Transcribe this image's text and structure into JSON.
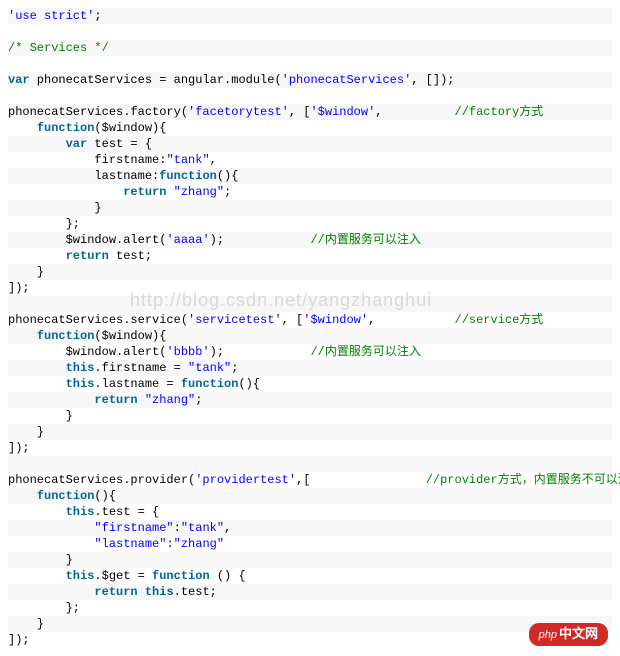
{
  "lines": [
    {
      "cls": "odd",
      "tokens": [
        {
          "t": "str",
          "x": "'use strict'"
        },
        {
          "t": "plain",
          "x": ";"
        }
      ]
    },
    {
      "cls": "even",
      "tokens": [
        {
          "t": "plain",
          "x": " "
        }
      ]
    },
    {
      "cls": "odd",
      "tokens": [
        {
          "t": "cmt",
          "x": "/* Services */"
        }
      ]
    },
    {
      "cls": "even",
      "tokens": [
        {
          "t": "plain",
          "x": " "
        }
      ]
    },
    {
      "cls": "odd",
      "tokens": [
        {
          "t": "kw",
          "x": "var"
        },
        {
          "t": "plain",
          "x": " phonecatServices = angular.module("
        },
        {
          "t": "str",
          "x": "'phonecatServices'"
        },
        {
          "t": "plain",
          "x": ", []);"
        }
      ]
    },
    {
      "cls": "even",
      "tokens": [
        {
          "t": "plain",
          "x": " "
        }
      ]
    },
    {
      "cls": "odd",
      "tokens": [
        {
          "t": "plain",
          "x": "phonecatServices.factory("
        },
        {
          "t": "str",
          "x": "'facetorytest'"
        },
        {
          "t": "plain",
          "x": ", ["
        },
        {
          "t": "str",
          "x": "'$window'"
        },
        {
          "t": "plain",
          "x": ",          "
        },
        {
          "t": "cmt",
          "x": "//factory方式"
        }
      ]
    },
    {
      "cls": "even",
      "tokens": [
        {
          "t": "plain",
          "x": "    "
        },
        {
          "t": "kw",
          "x": "function"
        },
        {
          "t": "plain",
          "x": "($window){"
        }
      ]
    },
    {
      "cls": "odd",
      "tokens": [
        {
          "t": "plain",
          "x": "        "
        },
        {
          "t": "kw",
          "x": "var"
        },
        {
          "t": "plain",
          "x": " test = {"
        }
      ]
    },
    {
      "cls": "even",
      "tokens": [
        {
          "t": "plain",
          "x": "            firstname:"
        },
        {
          "t": "str",
          "x": "\"tank\""
        },
        {
          "t": "plain",
          "x": ","
        }
      ]
    },
    {
      "cls": "odd",
      "tokens": [
        {
          "t": "plain",
          "x": "            lastname:"
        },
        {
          "t": "kw",
          "x": "function"
        },
        {
          "t": "plain",
          "x": "(){"
        }
      ]
    },
    {
      "cls": "even",
      "tokens": [
        {
          "t": "plain",
          "x": "                "
        },
        {
          "t": "kw",
          "x": "return"
        },
        {
          "t": "plain",
          "x": " "
        },
        {
          "t": "str",
          "x": "\"zhang\""
        },
        {
          "t": "plain",
          "x": ";"
        }
      ]
    },
    {
      "cls": "odd",
      "tokens": [
        {
          "t": "plain",
          "x": "            }"
        }
      ]
    },
    {
      "cls": "even",
      "tokens": [
        {
          "t": "plain",
          "x": "        };"
        }
      ]
    },
    {
      "cls": "odd",
      "tokens": [
        {
          "t": "plain",
          "x": "        $window.alert("
        },
        {
          "t": "str",
          "x": "'aaaa'"
        },
        {
          "t": "plain",
          "x": ");            "
        },
        {
          "t": "cmt",
          "x": "//内置服务可以注入"
        }
      ]
    },
    {
      "cls": "even",
      "tokens": [
        {
          "t": "plain",
          "x": "        "
        },
        {
          "t": "kw",
          "x": "return"
        },
        {
          "t": "plain",
          "x": " test;"
        }
      ]
    },
    {
      "cls": "odd",
      "tokens": [
        {
          "t": "plain",
          "x": "    }"
        }
      ]
    },
    {
      "cls": "even",
      "tokens": [
        {
          "t": "plain",
          "x": "]);"
        }
      ]
    },
    {
      "cls": "odd",
      "tokens": [
        {
          "t": "plain",
          "x": " "
        }
      ]
    },
    {
      "cls": "even",
      "tokens": [
        {
          "t": "plain",
          "x": "phonecatServices.service("
        },
        {
          "t": "str",
          "x": "'servicetest'"
        },
        {
          "t": "plain",
          "x": ", ["
        },
        {
          "t": "str",
          "x": "'$window'"
        },
        {
          "t": "plain",
          "x": ",           "
        },
        {
          "t": "cmt",
          "x": "//service方式"
        }
      ]
    },
    {
      "cls": "odd",
      "tokens": [
        {
          "t": "plain",
          "x": "    "
        },
        {
          "t": "kw",
          "x": "function"
        },
        {
          "t": "plain",
          "x": "($window){"
        }
      ]
    },
    {
      "cls": "even",
      "tokens": [
        {
          "t": "plain",
          "x": "        $window.alert("
        },
        {
          "t": "str",
          "x": "'bbbb'"
        },
        {
          "t": "plain",
          "x": ");            "
        },
        {
          "t": "cmt",
          "x": "//内置服务可以注入"
        }
      ]
    },
    {
      "cls": "odd",
      "tokens": [
        {
          "t": "plain",
          "x": "        "
        },
        {
          "t": "kw",
          "x": "this"
        },
        {
          "t": "plain",
          "x": ".firstname = "
        },
        {
          "t": "str",
          "x": "\"tank\""
        },
        {
          "t": "plain",
          "x": ";"
        }
      ]
    },
    {
      "cls": "even",
      "tokens": [
        {
          "t": "plain",
          "x": "        "
        },
        {
          "t": "kw",
          "x": "this"
        },
        {
          "t": "plain",
          "x": ".lastname = "
        },
        {
          "t": "kw",
          "x": "function"
        },
        {
          "t": "plain",
          "x": "(){"
        }
      ]
    },
    {
      "cls": "odd",
      "tokens": [
        {
          "t": "plain",
          "x": "            "
        },
        {
          "t": "kw",
          "x": "return"
        },
        {
          "t": "plain",
          "x": " "
        },
        {
          "t": "str",
          "x": "\"zhang\""
        },
        {
          "t": "plain",
          "x": ";"
        }
      ]
    },
    {
      "cls": "even",
      "tokens": [
        {
          "t": "plain",
          "x": "        }"
        }
      ]
    },
    {
      "cls": "odd",
      "tokens": [
        {
          "t": "plain",
          "x": "    }"
        }
      ]
    },
    {
      "cls": "even",
      "tokens": [
        {
          "t": "plain",
          "x": "]);"
        }
      ]
    },
    {
      "cls": "odd",
      "tokens": [
        {
          "t": "plain",
          "x": " "
        }
      ]
    },
    {
      "cls": "even",
      "tokens": [
        {
          "t": "plain",
          "x": "phonecatServices.provider("
        },
        {
          "t": "str",
          "x": "'providertest'"
        },
        {
          "t": "plain",
          "x": ",[                "
        },
        {
          "t": "cmt",
          "x": "//provider方式，内置服务不可以注入"
        }
      ]
    },
    {
      "cls": "odd",
      "tokens": [
        {
          "t": "plain",
          "x": "    "
        },
        {
          "t": "kw",
          "x": "function"
        },
        {
          "t": "plain",
          "x": "(){"
        }
      ]
    },
    {
      "cls": "even",
      "tokens": [
        {
          "t": "plain",
          "x": "        "
        },
        {
          "t": "kw",
          "x": "this"
        },
        {
          "t": "plain",
          "x": ".test = {"
        }
      ]
    },
    {
      "cls": "odd",
      "tokens": [
        {
          "t": "plain",
          "x": "            "
        },
        {
          "t": "str",
          "x": "\"firstname\""
        },
        {
          "t": "plain",
          "x": ":"
        },
        {
          "t": "str",
          "x": "\"tank\""
        },
        {
          "t": "plain",
          "x": ","
        }
      ]
    },
    {
      "cls": "even",
      "tokens": [
        {
          "t": "plain",
          "x": "            "
        },
        {
          "t": "str",
          "x": "\"lastname\""
        },
        {
          "t": "plain",
          "x": ":"
        },
        {
          "t": "str",
          "x": "\"zhang\""
        }
      ]
    },
    {
      "cls": "odd",
      "tokens": [
        {
          "t": "plain",
          "x": "        }"
        }
      ]
    },
    {
      "cls": "even",
      "tokens": [
        {
          "t": "plain",
          "x": "        "
        },
        {
          "t": "kw",
          "x": "this"
        },
        {
          "t": "plain",
          "x": ".$get = "
        },
        {
          "t": "kw",
          "x": "function"
        },
        {
          "t": "plain",
          "x": " () {"
        }
      ]
    },
    {
      "cls": "odd",
      "tokens": [
        {
          "t": "plain",
          "x": "            "
        },
        {
          "t": "kw",
          "x": "return"
        },
        {
          "t": "plain",
          "x": " "
        },
        {
          "t": "kw",
          "x": "this"
        },
        {
          "t": "plain",
          "x": ".test;"
        }
      ]
    },
    {
      "cls": "even",
      "tokens": [
        {
          "t": "plain",
          "x": "        };"
        }
      ]
    },
    {
      "cls": "odd",
      "tokens": [
        {
          "t": "plain",
          "x": "    }"
        }
      ]
    },
    {
      "cls": "even",
      "tokens": [
        {
          "t": "plain",
          "x": "]);"
        }
      ]
    }
  ],
  "watermark": "http://blog.csdn.net/yangzhanghui",
  "badge_prefix": "php",
  "badge_text": "中文网"
}
